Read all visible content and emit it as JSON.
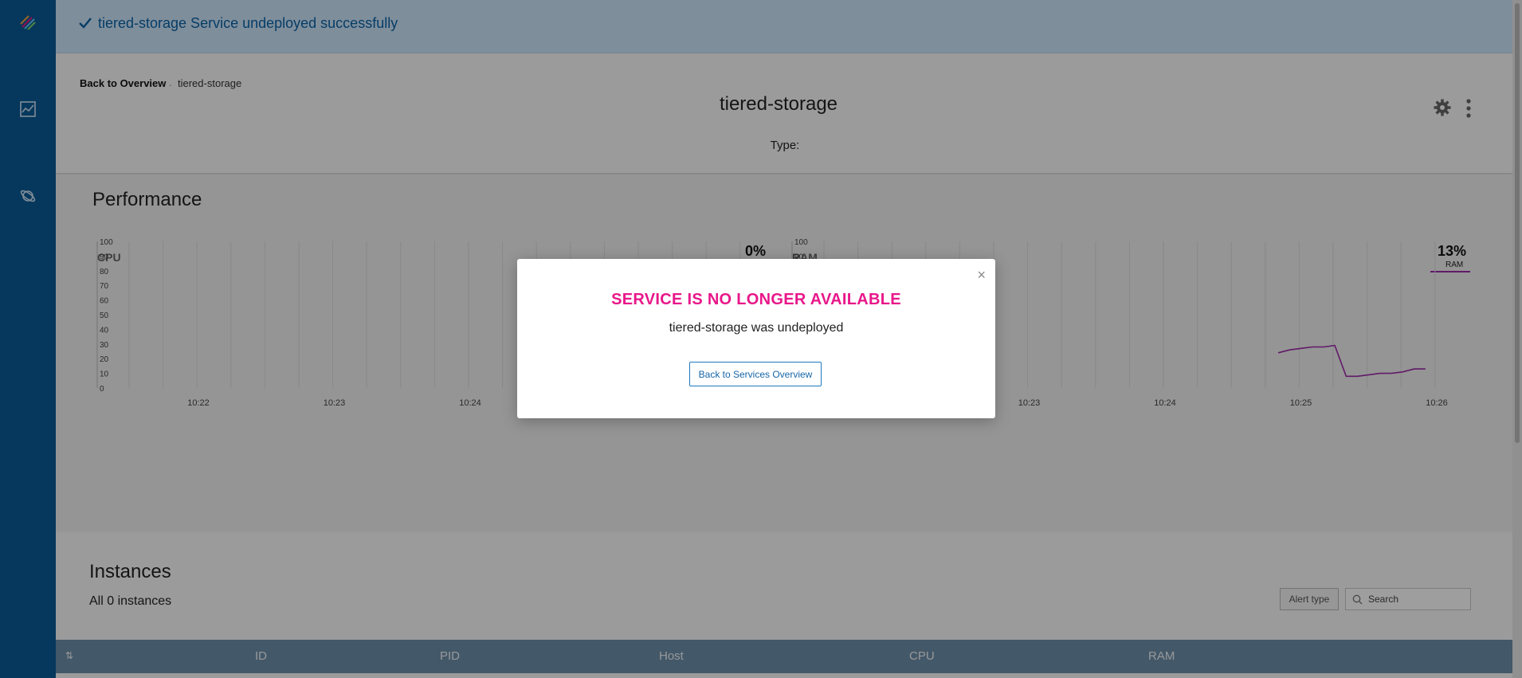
{
  "banner": {
    "message": "tiered-storage Service undeployed successfully"
  },
  "sidebar": {
    "items": [
      {
        "icon": "logo-icon"
      },
      {
        "icon": "chart-icon"
      },
      {
        "icon": "planet-icon"
      }
    ]
  },
  "header": {
    "back_link": "Back to Overview",
    "breadcrumb_separator": ".",
    "breadcrumb_current": "tiered-storage",
    "title": "tiered-storage",
    "type_label": "Type:"
  },
  "performance": {
    "title": "Performance",
    "cpu": {
      "label": "CPU",
      "value": "0%"
    },
    "ram": {
      "label": "RAM",
      "value": "13%",
      "sublabel": "RAM"
    }
  },
  "chart_data": [
    {
      "type": "line",
      "title": "CPU",
      "ylim": [
        0,
        100
      ],
      "yticks": [
        0,
        10,
        20,
        30,
        40,
        50,
        60,
        70,
        80,
        90,
        100
      ],
      "xticks": [
        "10:22",
        "10:23",
        "10:24",
        "10:25",
        "10:26"
      ],
      "grid": true,
      "color": "#1fbf9c",
      "series": [
        {
          "x": [
            "10:24:50",
            "10:24:55",
            "10:25:00",
            "10:25:05",
            "10:25:10",
            "10:25:20",
            "10:25:40",
            "10:26:00",
            "10:26:10"
          ],
          "values": [
            10,
            1,
            0,
            0,
            1,
            0,
            0,
            0,
            0
          ]
        }
      ]
    },
    {
      "type": "line",
      "title": "RAM",
      "ylim": [
        0,
        100
      ],
      "yticks": [
        0,
        10,
        20,
        30,
        40,
        50,
        60,
        70,
        80,
        90,
        100
      ],
      "xticks": [
        "10:22",
        "10:23",
        "10:24",
        "10:25",
        "10:26"
      ],
      "grid": true,
      "color": "#9b2aa8",
      "series": [
        {
          "name": "RAM",
          "x": [
            "10:24:50",
            "10:24:55",
            "10:25:00",
            "10:25:05",
            "10:25:10",
            "10:25:15",
            "10:25:20",
            "10:25:25",
            "10:25:30",
            "10:25:35",
            "10:25:40",
            "10:25:45",
            "10:25:50",
            "10:25:55"
          ],
          "values": [
            24,
            26,
            27,
            28,
            28,
            29,
            8,
            8,
            9,
            10,
            10,
            11,
            13,
            13
          ]
        }
      ]
    }
  ],
  "instances": {
    "title": "Instances",
    "count_label": "All 0 instances",
    "alert_type": "Alert type",
    "search_placeholder": "Search",
    "columns": [
      "ID",
      "PID",
      "Host",
      "CPU",
      "RAM"
    ]
  },
  "modal": {
    "title": "SERVICE IS NO LONGER AVAILABLE",
    "message": "tiered-storage was undeployed",
    "button": "Back to Services Overview",
    "close": "×"
  },
  "colors": {
    "sidebar": "#0b5b96",
    "accent": "#e8178a",
    "link": "#1565a8",
    "cpu_line": "#1fbf9c",
    "ram_line": "#9b2aa8"
  }
}
